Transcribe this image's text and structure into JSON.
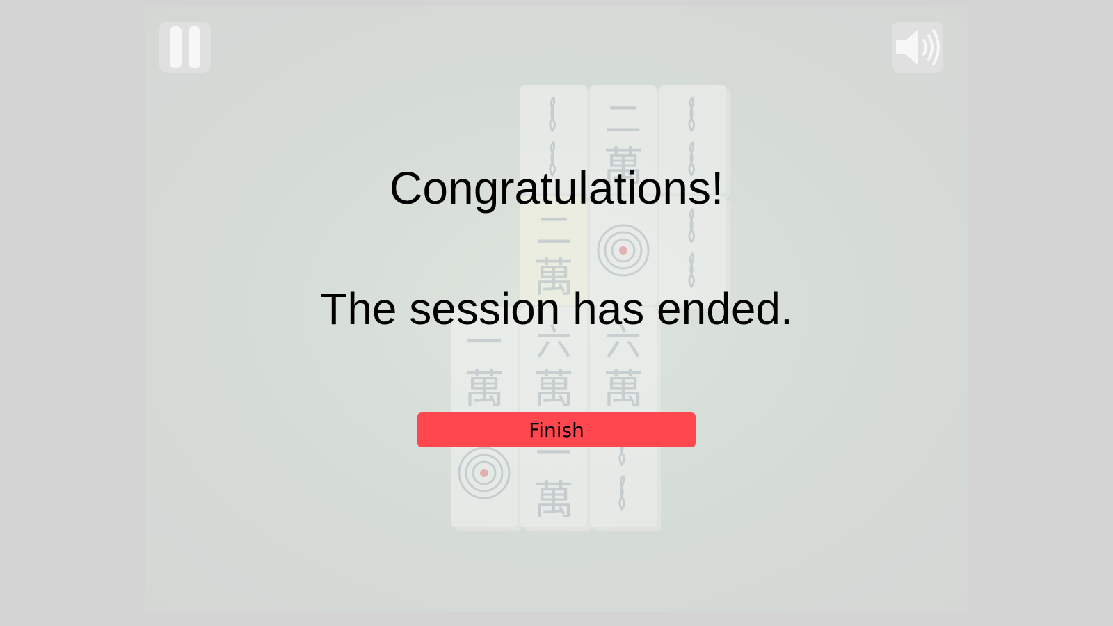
{
  "overlay": {
    "title": "Congratulations!",
    "message": "The session has ended.",
    "finish_label": "Finish"
  },
  "controls": {
    "pause_icon": "pause-icon",
    "sound_icon": "speaker-icon"
  },
  "tiles": [
    {
      "suit": "bamboo",
      "rank": 2
    },
    {
      "suit": "character",
      "rank": 2,
      "num": "二",
      "wan": "萬"
    },
    {
      "suit": "bamboo",
      "rank": 2
    },
    {
      "suit": "character",
      "rank": 2,
      "num": "二",
      "wan": "萬",
      "highlighted": true
    },
    {
      "suit": "circle",
      "rank": 1
    },
    {
      "suit": "bamboo",
      "rank": 2
    },
    {
      "suit": "character",
      "rank": 1,
      "num": "一",
      "wan": "萬"
    },
    {
      "suit": "character",
      "rank": 6,
      "num": "六",
      "wan": "萬"
    },
    {
      "suit": "character",
      "rank": 6,
      "num": "六",
      "wan": "萬"
    },
    {
      "suit": "circle",
      "rank": 1
    },
    {
      "suit": "character",
      "rank": 1,
      "num": "一",
      "wan": "萬"
    },
    {
      "suit": "bamboo",
      "rank": 2
    }
  ],
  "colors": {
    "background": "#d4d4d4",
    "finish_button": "#ff474f",
    "tile_face": "#f4f4f4",
    "tile_glyph": "#b9c0c8",
    "circle_center": "#e88b8e"
  }
}
